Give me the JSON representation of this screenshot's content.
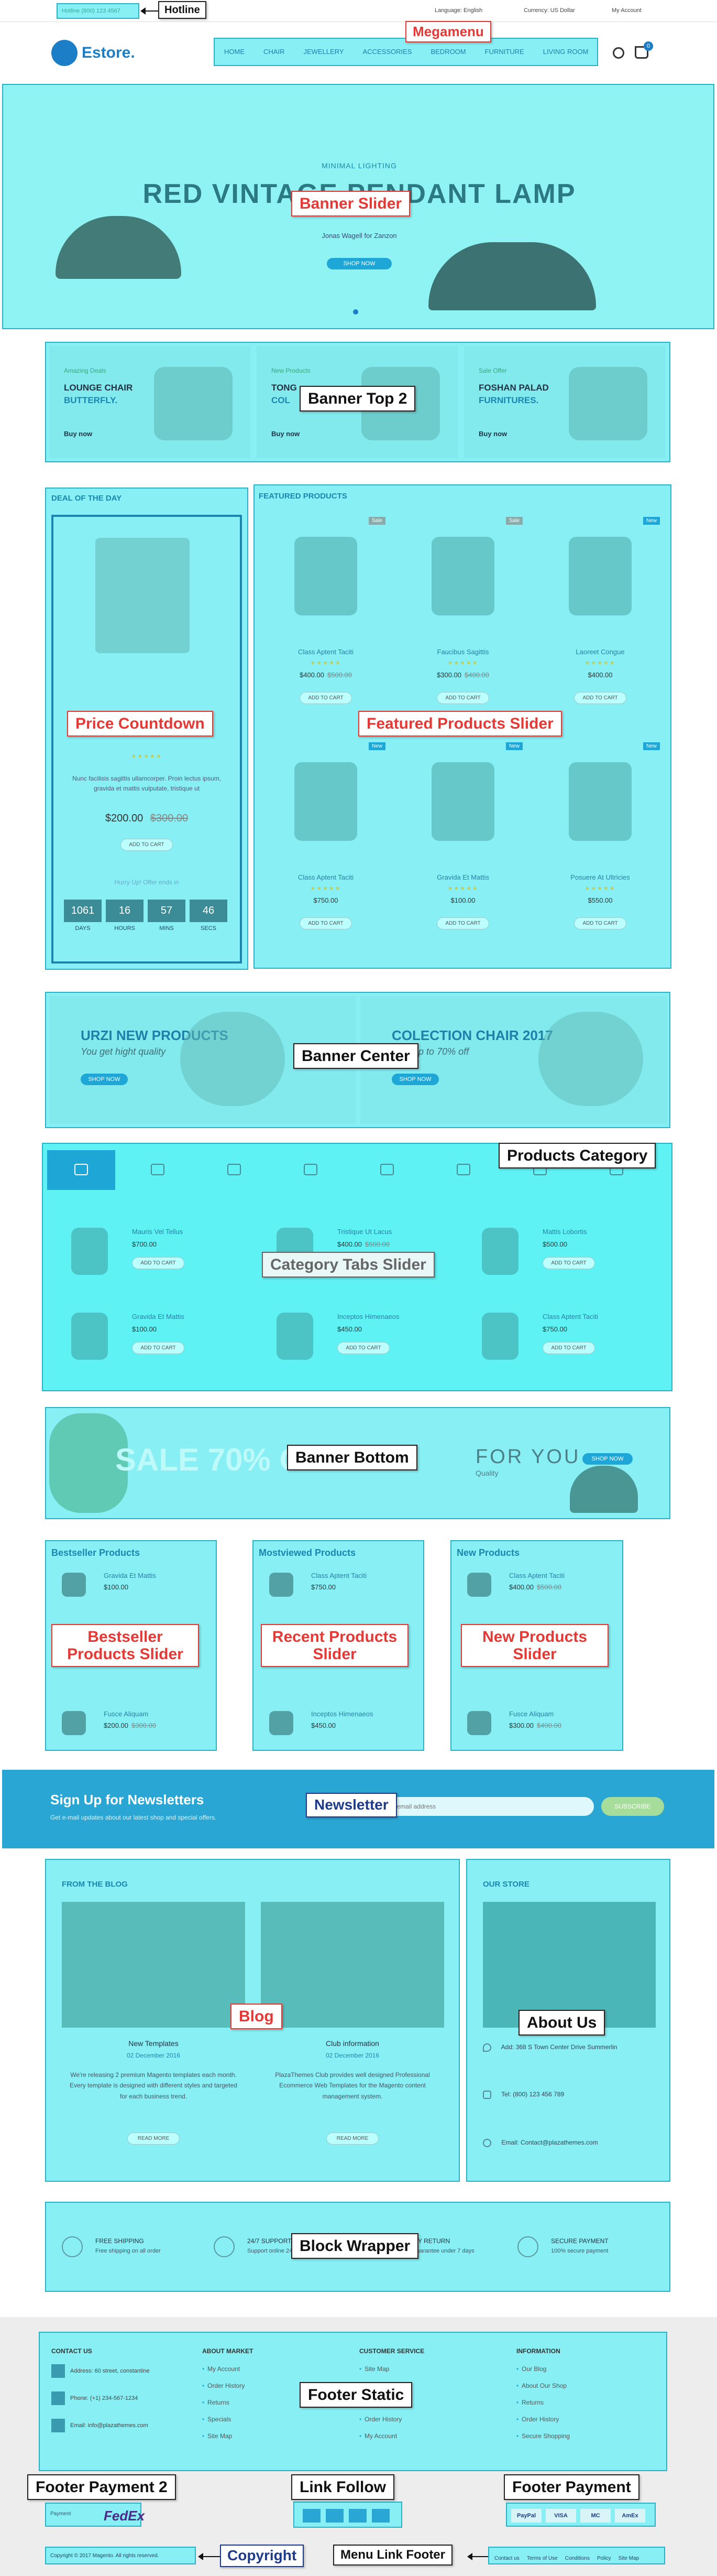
{
  "labels": {
    "hotline": "Hotline",
    "megamenu": "Megamenu",
    "banner_slider": "Banner Slider",
    "banner_top2": "Banner Top 2",
    "price_countdown": "Price Countdown",
    "featured_slider": "Featured Products Slider",
    "banner_center": "Banner Center",
    "products_category": "Products Category",
    "category_tabs": "Category Tabs Slider",
    "banner_bottom": "Banner Bottom",
    "bestseller_slider": "Bestseller Products Slider",
    "recent_slider": "Recent Products Slider",
    "new_slider": "New Products Slider",
    "newsletter": "Newsletter",
    "blog": "Blog",
    "about_us": "About Us",
    "block_wrapper": "Block Wrapper",
    "footer_static": "Footer Static",
    "footer_payment2": "Footer Payment 2",
    "link_follow": "Link Follow",
    "footer_payment": "Footer Payment",
    "copyright": "Copyright",
    "menu_link_footer": "Menu Link Footer"
  },
  "topbar": {
    "hotline_text": "Hotline (800) 123 4567",
    "language": "Language: English",
    "currency": "Currency: US Dollar",
    "my_account": "My Account"
  },
  "header": {
    "logo": "Estore.",
    "cart_count": "0",
    "menu": [
      "HOME",
      "CHAIR",
      "JEWELLERY",
      "ACCESSORIES",
      "BEDROOM",
      "FURNITURE",
      "LIVING ROOM"
    ]
  },
  "slider": {
    "subtitle": "MINIMAL LIGHTING",
    "title": "RED VINTAGE PENDANT LAMP",
    "author": "Jonas Wagell for Zanzon",
    "button": "SHOP NOW"
  },
  "banner_top": [
    {
      "kicker": "Amazing Deals",
      "title1": "LOUNGE CHAIR",
      "title2": "BUTTERFLY.",
      "link": "Buy now"
    },
    {
      "kicker": "New Products",
      "title1": "TONG",
      "title2": "COL",
      "link": "Buy now"
    },
    {
      "kicker": "Sale Offer",
      "title1": "FOSHAN PALAD",
      "title2": "FURNITURES.",
      "link": "Buy now"
    }
  ],
  "deal": {
    "heading": "DEAL OF THE DAY",
    "desc": "Nunc facilisis sagittis ullamcorper. Proin lectus ipsum, gravida et mattis vulputate, tristique ut",
    "price": "$200.00",
    "old_price": "$300.00",
    "button": "ADD TO CART",
    "note": "Hurry Up! Offer ends in",
    "countdown": [
      {
        "value": "1061",
        "unit": "DAYS"
      },
      {
        "value": "16",
        "unit": "HOURS"
      },
      {
        "value": "57",
        "unit": "MINS"
      },
      {
        "value": "46",
        "unit": "SECS"
      }
    ]
  },
  "featured": {
    "heading": "FEATURED PRODUCTS",
    "items": [
      {
        "name": "Class Aptent Taciti",
        "price": "$400.00",
        "old": "$500.00",
        "tag": "Sale",
        "btn": "ADD TO CART"
      },
      {
        "name": "Faucibus Sagittis",
        "price": "$300.00",
        "old": "$400.00",
        "tag": "Sale",
        "btn": "ADD TO CART"
      },
      {
        "name": "Laoreet Congue",
        "price": "$400.00",
        "old": "",
        "tag": "New",
        "btn": "ADD TO CART"
      },
      {
        "name": "Class Aptent Taciti",
        "price": "$750.00",
        "old": "",
        "tag": "New",
        "btn": "ADD TO CART"
      },
      {
        "name": "Gravida Et Mattis",
        "price": "$100.00",
        "old": "",
        "tag": "New",
        "btn": "ADD TO CART"
      },
      {
        "name": "Posuere At Ultricies",
        "price": "$550.00",
        "old": "",
        "tag": "New",
        "btn": "ADD TO CART"
      }
    ]
  },
  "banner_center": [
    {
      "title": "URZI NEW PRODUCTS",
      "sub": "You get hight quality",
      "btn": "SHOP NOW"
    },
    {
      "title": "COLECTION CHAIR 2017",
      "sub": "Sale up to 70% off",
      "btn": "SHOP NOW"
    }
  ],
  "category": {
    "items": [
      {
        "name": "Mauris Vel Tellus",
        "price": "$700.00",
        "btn": "ADD TO CART"
      },
      {
        "name": "Tristique Ut Lacus",
        "price": "$400.00",
        "old": "$500.00",
        "btn": "ADD TO CART"
      },
      {
        "name": "Mattis Lobortis",
        "price": "$500.00",
        "btn": "ADD TO CART"
      },
      {
        "name": "Gravida Et Mattis",
        "price": "$100.00",
        "btn": "ADD TO CART"
      },
      {
        "name": "Inceptos Himenaeos",
        "price": "$450.00",
        "btn": "ADD TO CART"
      },
      {
        "name": "Class Aptent Taciti",
        "price": "$750.00",
        "btn": "ADD TO CART"
      }
    ]
  },
  "banner_bottom": {
    "text": "SALE 70% O",
    "text2": "FOR YOU",
    "sub": "Quality",
    "btn": "SHOP NOW"
  },
  "bestseller": {
    "heading": "Bestseller Products",
    "top": {
      "name": "Gravida Et Mattis",
      "price": "$100.00"
    },
    "bottom": {
      "name": "Fusce Aliquam",
      "price": "$200.00",
      "old": "$300.00"
    }
  },
  "mostviewed": {
    "heading": "Mostviewed Products",
    "top": {
      "name": "Class Aptent Taciti",
      "price": "$750.00"
    },
    "bottom": {
      "name": "Inceptos Himenaeos",
      "price": "$450.00"
    }
  },
  "newproducts": {
    "heading": "New Products",
    "top": {
      "name": "Class Aptent Taciti",
      "price": "$400.00",
      "old": "$500.00"
    },
    "bottom": {
      "name": "Fusce Aliquam",
      "price": "$300.00",
      "old": "$400.00"
    }
  },
  "newsletter_block": {
    "title": "Sign Up for Newsletters",
    "sub": "Get e-mail updates about our latest shop and special offers.",
    "placeholder": "Your email address",
    "button": "SUBSCRIBE"
  },
  "blog_block": {
    "heading": "FROM THE BLOG",
    "posts": [
      {
        "title": "New Templates",
        "date": "02 December 2016",
        "text": "We're releasing 2 premium Magento templates each month. Every template is designed with different styles and targeted for each business trend.",
        "btn": "READ MORE"
      },
      {
        "title": "Club information",
        "date": "02 December 2016",
        "text": "PlazaThemes Club provides well designed Professional Ecommerce Web Templates for the Magento content management system.",
        "btn": "READ MORE"
      }
    ]
  },
  "store": {
    "heading": "OUR STORE",
    "address": "Add: 368 S Town Center Drive Summerlin",
    "phone": "Tel: (800) 123 456 789",
    "email": "Email: Contact@plazathemes.com"
  },
  "services": [
    {
      "title": "FREE SHIPPING",
      "sub": "Free shipping on all order"
    },
    {
      "title": "24/7 SUPPORT",
      "sub": "Support online 24 hours"
    },
    {
      "title": "MONEY RETURN",
      "sub": "Back guarantee under 7 days"
    },
    {
      "title": "SECURE PAYMENT",
      "sub": "100% secure payment"
    }
  ],
  "footer": {
    "contact_heading": "CONTACT US",
    "address": "Address: 60 street, constantine",
    "phone": "Phone: (+1) 234-567-1234",
    "email": "Email: info@plazathemes.com",
    "cols": [
      {
        "heading": "ABOUT MARKET",
        "links": [
          "My Account",
          "Order History",
          "Returns",
          "Specials",
          "Site Map"
        ]
      },
      {
        "heading": "CUSTOMER SERVICE",
        "links": [
          "Site Map",
          "Contact us",
          "Shipping",
          "Order History",
          "My Account"
        ]
      },
      {
        "heading": "INFORMATION",
        "links": [
          "Our Blog",
          "About Our Shop",
          "Returns",
          "Order History",
          "Secure Shopping"
        ]
      }
    ],
    "copyright": "Copyright © 2017 Magento. All rights reserved.",
    "bottom_links": [
      "Contact us",
      "Terms of Use",
      "Conditions",
      "Policy",
      "Site Map"
    ],
    "payment2": [
      "Payment",
      "FedEx"
    ],
    "payment": [
      "PayPal",
      "VISA",
      "MC",
      "AmEx"
    ]
  },
  "colors": {
    "accent": "#1ea7d6",
    "overlay": "#88f0f4",
    "label_red": "#e53935",
    "newsletter_bg": "#2aa6d4"
  }
}
